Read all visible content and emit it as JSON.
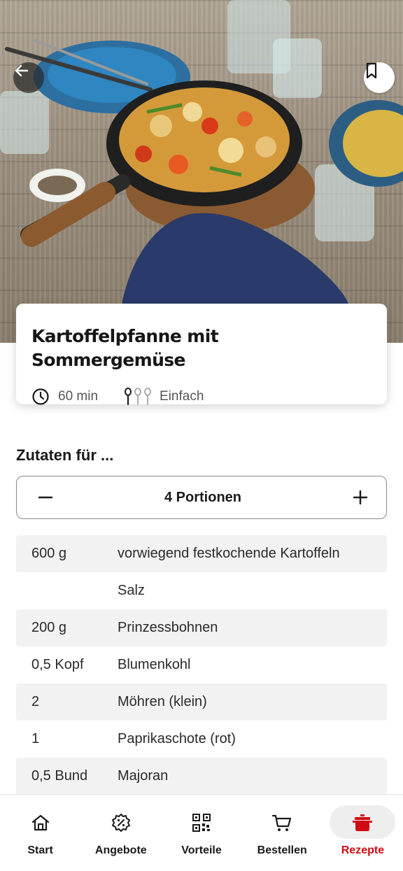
{
  "hero": {
    "back_icon": "arrow-left-icon",
    "bookmark_icon": "bookmark-icon"
  },
  "recipe": {
    "title": "Kartoffelpfanne mit Sommergemüse",
    "duration": "60 min",
    "difficulty": "Einfach",
    "difficulty_level": 1,
    "difficulty_max": 3
  },
  "ingredients": {
    "heading": "Zutaten für ...",
    "portions_label": "4 Portionen",
    "items": [
      {
        "qty": "600 g",
        "name": "vorwiegend festkochende Kartoffeln"
      },
      {
        "qty": "",
        "name": "Salz"
      },
      {
        "qty": "200 g",
        "name": "Prinzessbohnen"
      },
      {
        "qty": "0,5 Kopf",
        "name": "Blumenkohl"
      },
      {
        "qty": "2",
        "name": "Möhren (klein)"
      },
      {
        "qty": "1",
        "name": "Paprikaschote (rot)"
      },
      {
        "qty": "0,5 Bund",
        "name": "Majoran"
      }
    ]
  },
  "nav": {
    "items": [
      {
        "label": "Start",
        "icon": "home-icon"
      },
      {
        "label": "Angebote",
        "icon": "discount-badge-icon"
      },
      {
        "label": "Vorteile",
        "icon": "qr-code-icon"
      },
      {
        "label": "Bestellen",
        "icon": "shopping-cart-icon"
      },
      {
        "label": "Rezepte",
        "icon": "cooking-pot-icon"
      }
    ],
    "active": "Rezepte"
  },
  "colors": {
    "accent": "#d20a11",
    "shade_row": "#f2f2f2"
  }
}
